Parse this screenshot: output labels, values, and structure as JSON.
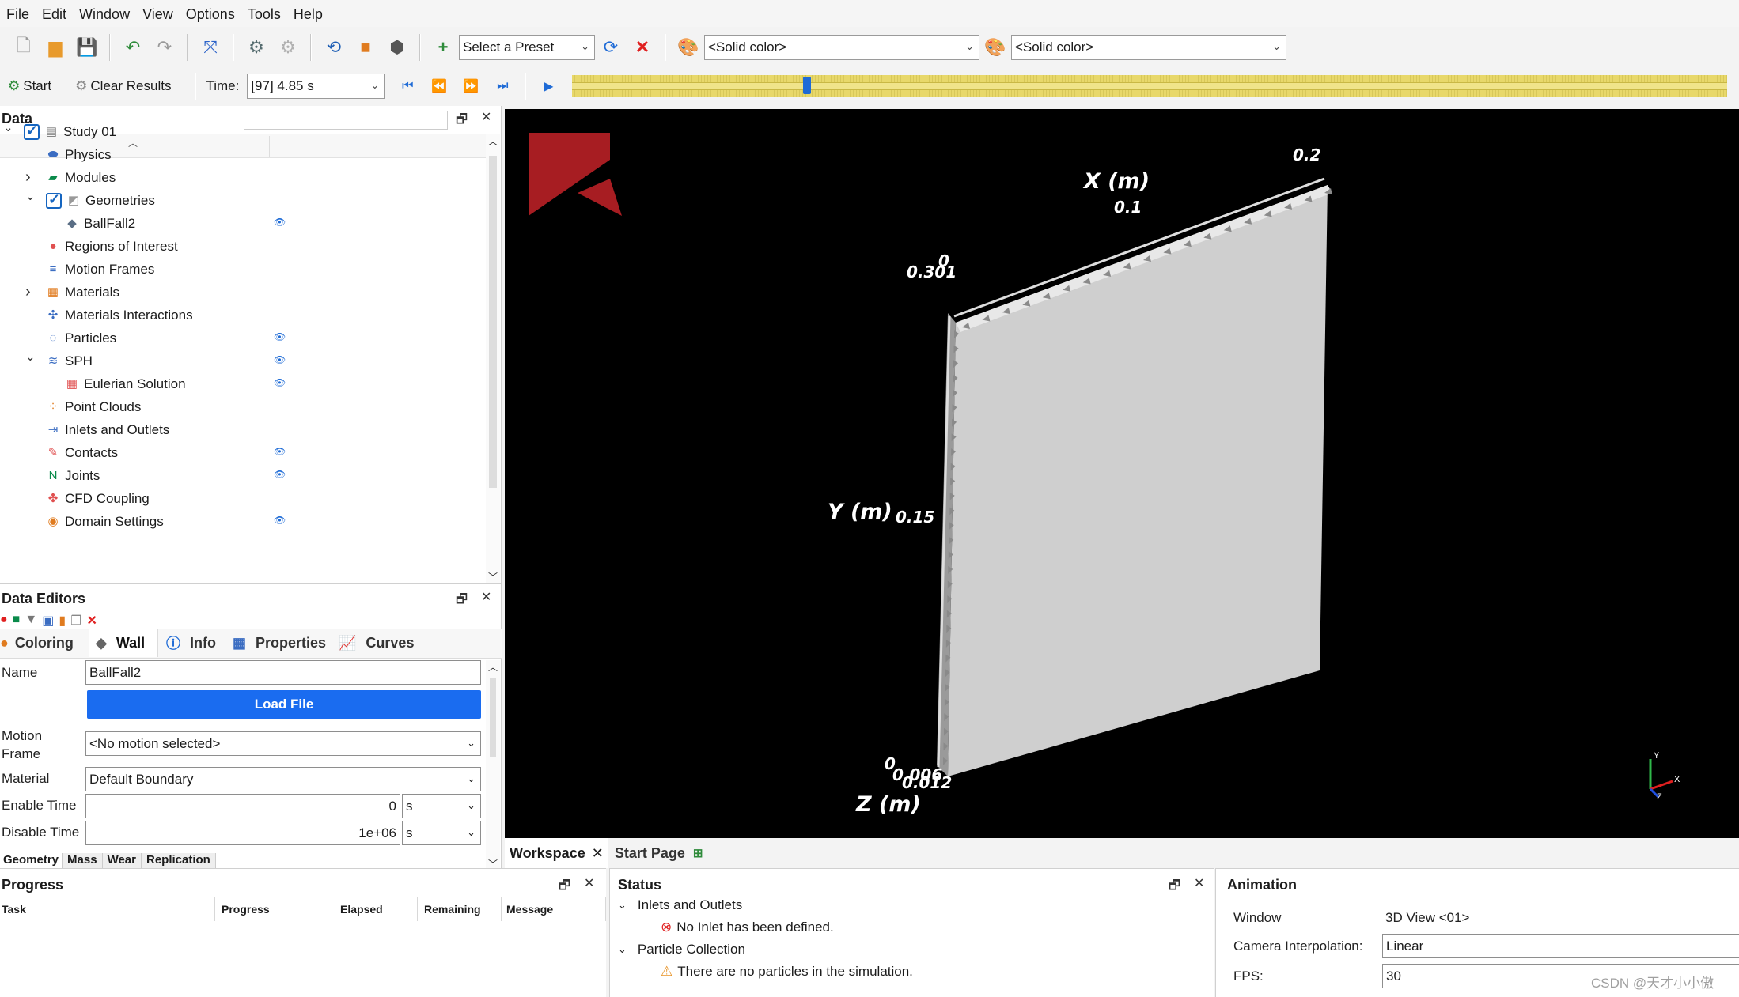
{
  "menu": [
    "File",
    "Edit",
    "Window",
    "View",
    "Options",
    "Tools",
    "Help"
  ],
  "toolbar": {
    "preset": "Select a Preset",
    "color1": "<Solid color>",
    "color2": "<Solid color>",
    "start": "Start",
    "clear_results": "Clear Results",
    "time_label": "Time:",
    "time_value": "[97] 4.85 s",
    "timeline_position": 0.2
  },
  "data_panel": {
    "title": "Data",
    "tree": [
      {
        "label": "Study 01",
        "icon": "study-icon",
        "level": 0,
        "expander": "expanded",
        "checkbox": true,
        "eye": false
      },
      {
        "label": "Physics",
        "icon": "physics-icon",
        "level": 1,
        "expander": "",
        "checkbox": false,
        "eye": false
      },
      {
        "label": "Modules",
        "icon": "modules-icon",
        "level": 1,
        "expander": "collapsed",
        "checkbox": false,
        "eye": false
      },
      {
        "label": "Geometries",
        "icon": "geometries-icon",
        "level": 1,
        "expander": "expanded",
        "checkbox": true,
        "eye": false
      },
      {
        "label": "BallFall2",
        "icon": "geometry-icon",
        "level": 2,
        "expander": "",
        "checkbox": false,
        "eye": true
      },
      {
        "label": "Regions of Interest",
        "icon": "regions-icon",
        "level": 1,
        "expander": "",
        "checkbox": false,
        "eye": false
      },
      {
        "label": "Motion Frames",
        "icon": "motion-frames-icon",
        "level": 1,
        "expander": "",
        "checkbox": false,
        "eye": false
      },
      {
        "label": "Materials",
        "icon": "materials-icon",
        "level": 1,
        "expander": "collapsed",
        "checkbox": false,
        "eye": false
      },
      {
        "label": "Materials Interactions",
        "icon": "materials-interactions-icon",
        "level": 1,
        "expander": "",
        "checkbox": false,
        "eye": false
      },
      {
        "label": "Particles",
        "icon": "particles-icon",
        "level": 1,
        "expander": "",
        "checkbox": false,
        "eye": true
      },
      {
        "label": "SPH",
        "icon": "sph-icon",
        "level": 1,
        "expander": "expanded",
        "checkbox": false,
        "eye": true
      },
      {
        "label": "Eulerian Solution",
        "icon": "eulerian-icon",
        "level": 2,
        "expander": "",
        "checkbox": false,
        "eye": true
      },
      {
        "label": "Point Clouds",
        "icon": "point-clouds-icon",
        "level": 1,
        "expander": "",
        "checkbox": false,
        "eye": false
      },
      {
        "label": "Inlets and Outlets",
        "icon": "inlets-icon",
        "level": 1,
        "expander": "",
        "checkbox": false,
        "eye": false
      },
      {
        "label": "Contacts",
        "icon": "contacts-icon",
        "level": 1,
        "expander": "",
        "checkbox": false,
        "eye": true
      },
      {
        "label": "Joints",
        "icon": "joints-icon",
        "level": 1,
        "expander": "",
        "checkbox": false,
        "eye": true
      },
      {
        "label": "CFD Coupling",
        "icon": "cfd-icon",
        "level": 1,
        "expander": "",
        "checkbox": false,
        "eye": false
      },
      {
        "label": "Domain Settings",
        "icon": "domain-icon",
        "level": 1,
        "expander": "",
        "checkbox": false,
        "eye": true
      }
    ]
  },
  "editors": {
    "title": "Data Editors",
    "tabs": [
      "Coloring",
      "Wall",
      "Info",
      "Properties",
      "Curves"
    ],
    "name_label": "Name",
    "name_value": "BallFall2",
    "load_file": "Load File",
    "motion_label": "Motion Frame",
    "motion_value": "<No motion selected>",
    "material_label": "Material",
    "material_value": "Default Boundary",
    "enable_label": "Enable Time",
    "enable_value": "0",
    "enable_unit": "s",
    "disable_label": "Disable Time",
    "disable_value": "1e+06",
    "disable_unit": "s",
    "subtabs": [
      "Geometry",
      "Mass",
      "Wear",
      "Replication"
    ]
  },
  "viewport": {
    "x_label": "X (m)",
    "y_label": "Y (m)",
    "z_label": "Z (m)",
    "x_ticks": [
      "0",
      "0.1",
      "0.2"
    ],
    "y_ticks": [
      "0.301",
      "0.15",
      "0"
    ],
    "z_ticks": [
      "0.006",
      "0.012"
    ],
    "triad": [
      "Y",
      "X",
      "Z"
    ]
  },
  "bottom_tabs": [
    "Workspace",
    "Start Page"
  ],
  "progress": {
    "title": "Progress",
    "columns": [
      "Task",
      "Progress",
      "Elapsed",
      "Remaining",
      "Message"
    ]
  },
  "status": {
    "title": "Status",
    "groups": [
      {
        "label": "Inlets and Outlets",
        "message": "No Inlet has been defined.",
        "severity": "error"
      },
      {
        "label": "Particle Collection",
        "message": "There are no particles in the simulation.",
        "severity": "warning"
      }
    ]
  },
  "animation": {
    "title": "Animation",
    "window_label": "Window",
    "window_value": "3D View <01>",
    "interp_label": "Camera Interpolation:",
    "interp_value": "Linear",
    "fps_label": "FPS:",
    "fps_value": "30"
  },
  "watermark": "CSDN @天才小小傲",
  "colors": {
    "accent": "#1a6cf0",
    "brand": "#a71d22",
    "timeline": "#e8d86a"
  }
}
